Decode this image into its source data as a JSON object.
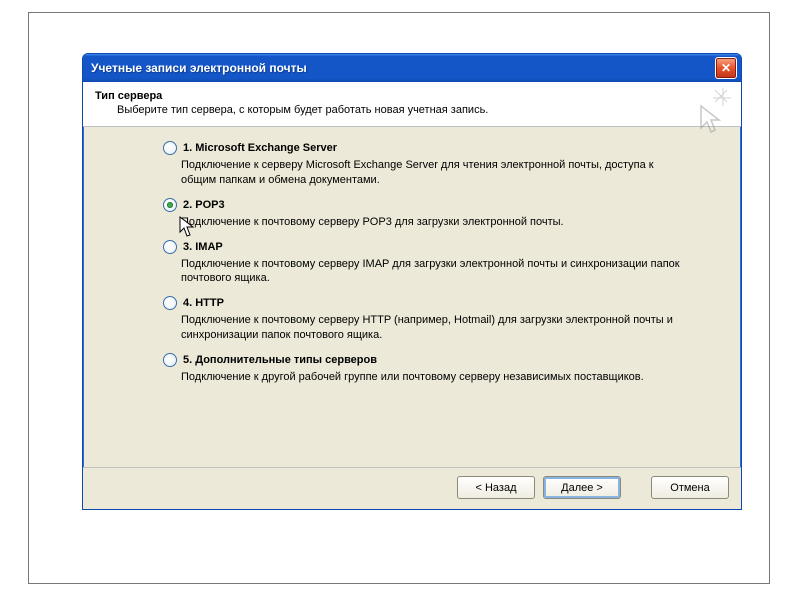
{
  "window": {
    "title": "Учетные записи электронной почты"
  },
  "header": {
    "title": "Тип сервера",
    "subtitle": "Выберите тип сервера, с которым будет работать новая учетная запись."
  },
  "options": [
    {
      "label": "1. Microsoft Exchange Server",
      "desc": "Подключение к серверу Microsoft Exchange Server для чтения электронной почты, доступа к общим папкам и обмена документами.",
      "checked": false
    },
    {
      "label": "2. POP3",
      "desc": "Подключение к почтовому серверу POP3 для загрузки электронной почты.",
      "checked": true
    },
    {
      "label": "3. IMAP",
      "desc": "Подключение к почтовому серверу IMAP для загрузки электронной почты и синхронизации папок почтового ящика.",
      "checked": false
    },
    {
      "label": "4. HTTP",
      "desc": "Подключение к почтовому серверу HTTP (например, Hotmail) для загрузки электронной почты и синхронизации папок почтового ящика.",
      "checked": false
    },
    {
      "label": "5. Дополнительные типы серверов",
      "desc": "Подключение к другой рабочей группе или почтовому серверу независимых поставщиков.",
      "checked": false
    }
  ],
  "buttons": {
    "back": "< Назад",
    "next": "Далее >",
    "cancel": "Отмена"
  }
}
